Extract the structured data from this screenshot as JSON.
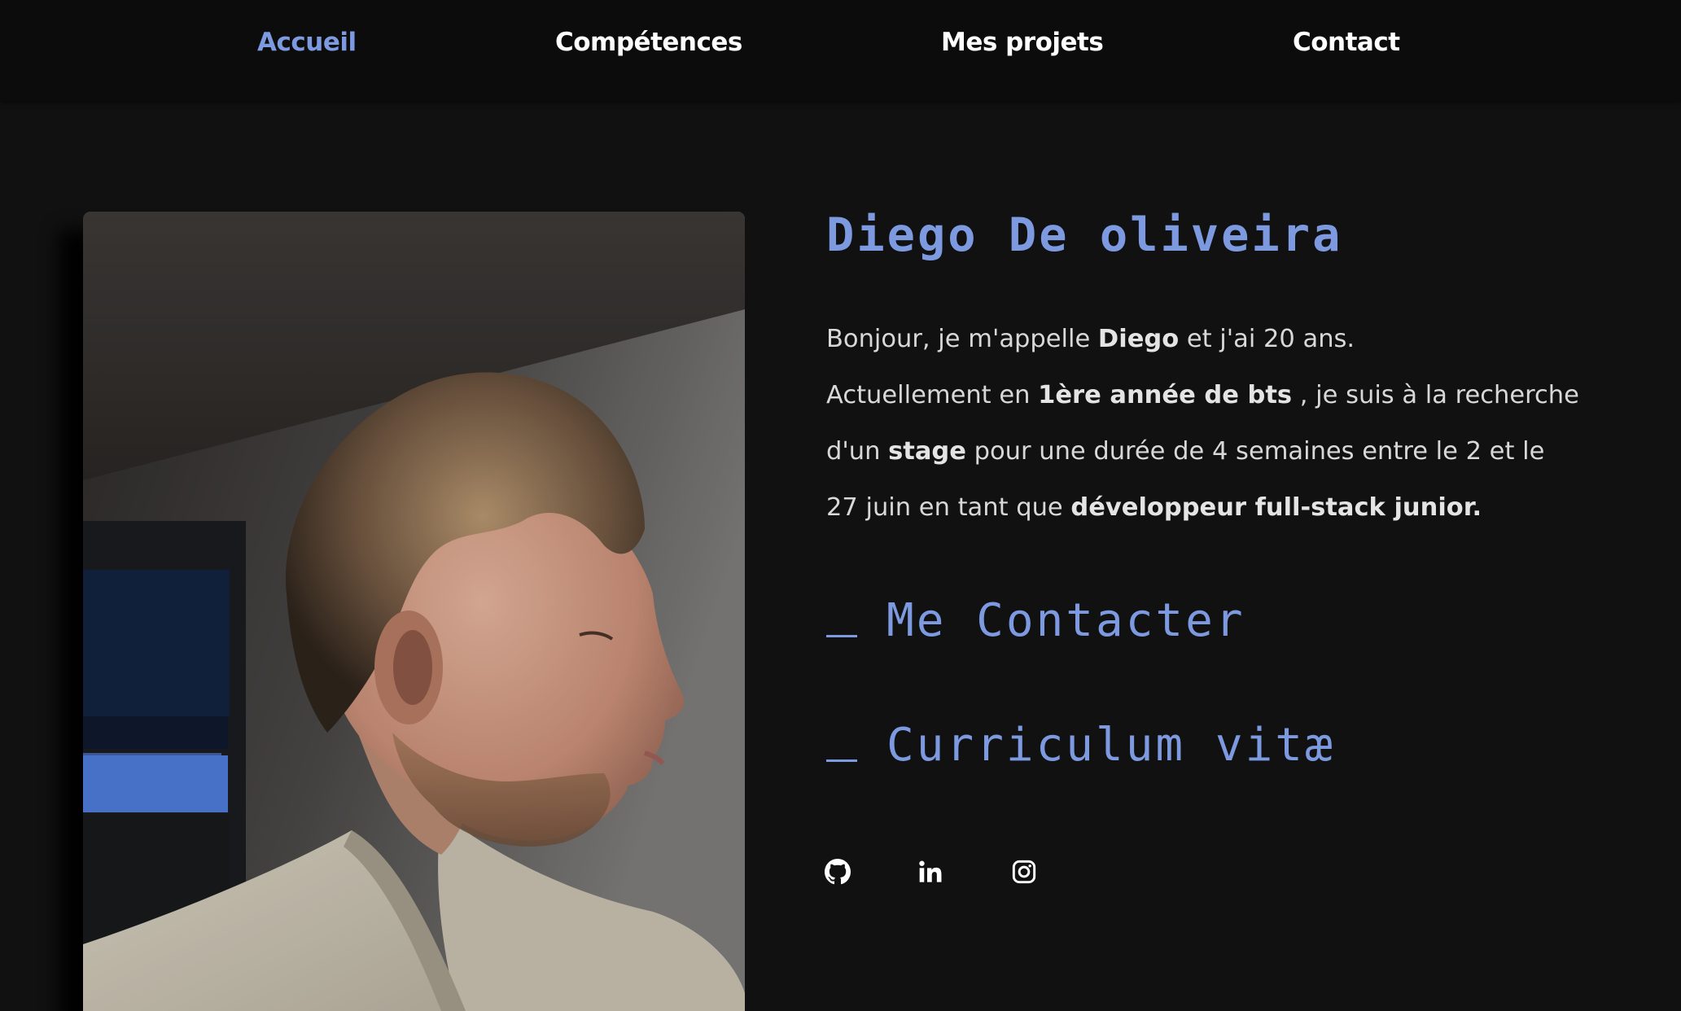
{
  "nav": {
    "items": [
      {
        "label": "Accueil",
        "active": true
      },
      {
        "label": "Compétences",
        "active": false
      },
      {
        "label": "Mes projets",
        "active": false
      },
      {
        "label": "Contact",
        "active": false
      }
    ]
  },
  "hero": {
    "name": "Diego De oliveira",
    "bio": {
      "line1_a": "Bonjour, je m'appelle ",
      "line1_b": "Diego",
      "line1_c": " et j'ai 20 ans.",
      "line2_a": "Actuellement en ",
      "line2_b": "1ère année de bts",
      "line2_c": " , je suis à la recherche",
      "line3_a": "d'un ",
      "line3_b": "stage",
      "line3_c": " pour une durée de 4 semaines entre le 2 et le",
      "line4_a": "27 juin en tant que ",
      "line4_b": "développeur full-stack junior."
    },
    "contact_link": "Me Contacter",
    "cv_link": "Curriculum vitæ"
  },
  "socials": [
    {
      "icon": "github-icon"
    },
    {
      "icon": "linkedin-icon"
    },
    {
      "icon": "instagram-icon"
    }
  ],
  "colors": {
    "background": "#111111",
    "nav_background": "#0c0c0c",
    "accent": "#7d9ae0",
    "text": "#d8d8d8"
  }
}
